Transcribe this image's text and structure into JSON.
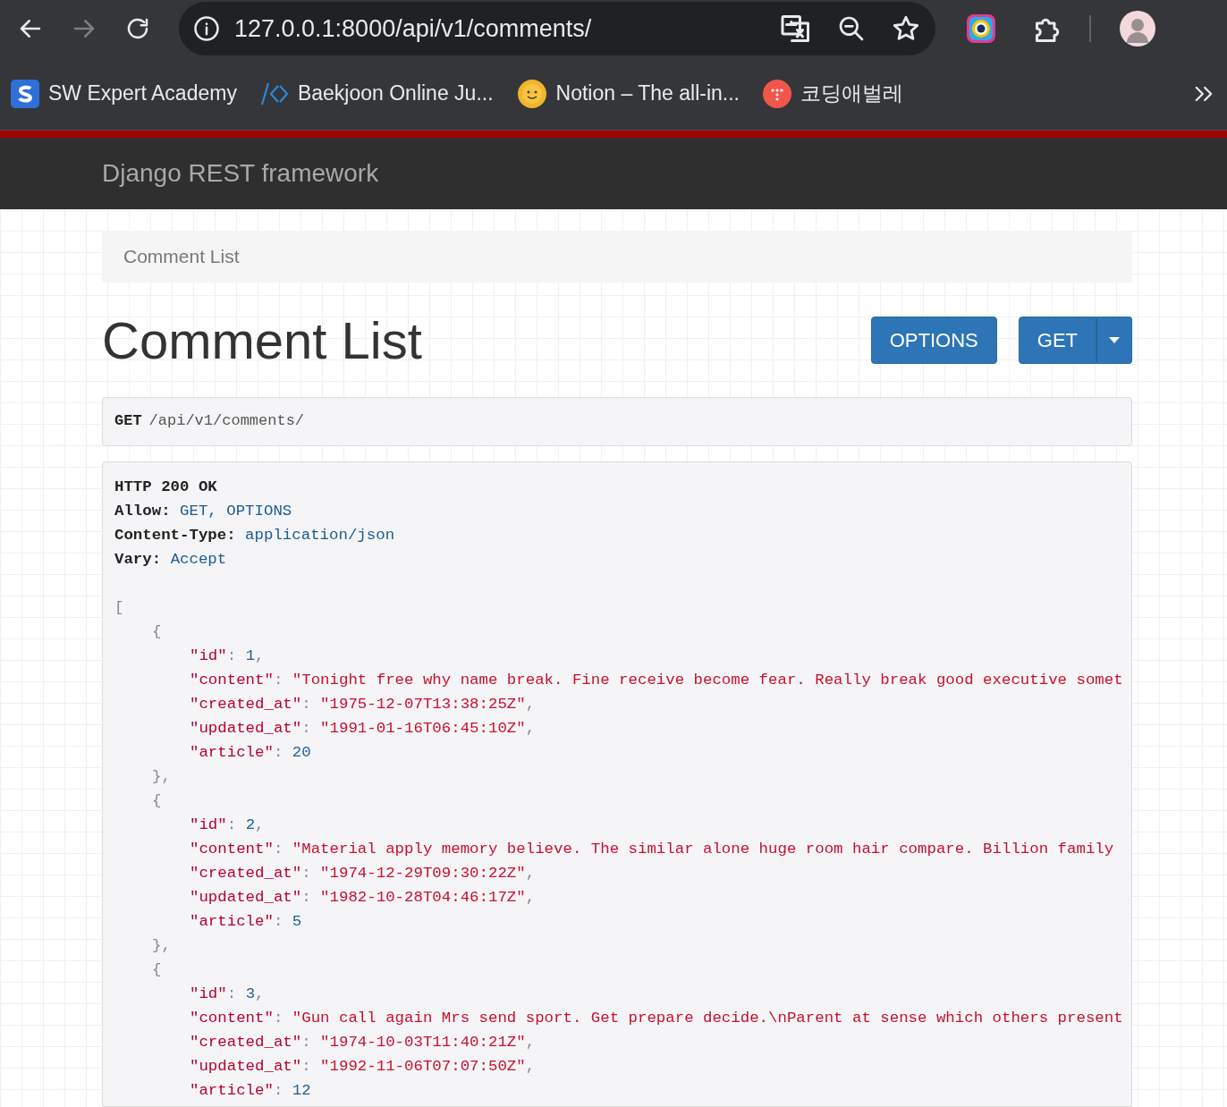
{
  "browser": {
    "nav_buttons": [
      {
        "kind": "back",
        "disabled": false
      },
      {
        "kind": "forward",
        "disabled": true
      },
      {
        "kind": "reload",
        "disabled": false
      }
    ],
    "url": "127.0.0.1:8000/api/v1/comments/",
    "bookmarks": [
      {
        "label": "SW Expert Academy",
        "kind": "s"
      },
      {
        "label": "Baekjoon Online Ju...",
        "kind": "code"
      },
      {
        "label": "Notion – The all-in...",
        "kind": "sun"
      },
      {
        "label": "코딩애벌레",
        "kind": "dots"
      }
    ]
  },
  "navbar": {
    "brand": "Django REST framework"
  },
  "breadcrumb": [
    "Comment List"
  ],
  "page_title": "Comment List",
  "buttons": [
    {
      "label": "OPTIONS",
      "kind": "plain"
    },
    {
      "label": "GET",
      "kind": "split"
    }
  ],
  "request": {
    "method": "GET",
    "path": "/api/v1/comments/"
  },
  "response": {
    "status": "HTTP 200 OK",
    "headers": [
      {
        "name": "Allow:",
        "value": "GET, OPTIONS"
      },
      {
        "name": "Content-Type:",
        "value": "application/json"
      },
      {
        "name": "Vary:",
        "value": "Accept"
      }
    ],
    "open": "[",
    "items": [
      {
        "open": "{",
        "close": "},",
        "fields": [
          {
            "key": "\"id\"",
            "colon": ":",
            "value": "1",
            "kind": "number",
            "comma": ","
          },
          {
            "key": "\"content\"",
            "colon": ":",
            "value": "\"Tonight free why name break. Fine receive become fear. Really break good executive somet",
            "kind": "string"
          },
          {
            "key": "\"created_at\"",
            "colon": ":",
            "value": "\"1975-12-07T13:38:25Z\"",
            "kind": "string",
            "comma": ","
          },
          {
            "key": "\"updated_at\"",
            "colon": ":",
            "value": "\"1991-01-16T06:45:10Z\"",
            "kind": "string",
            "comma": ","
          },
          {
            "key": "\"article\"",
            "colon": ":",
            "value": "20",
            "kind": "number"
          }
        ]
      },
      {
        "open": "{",
        "close": "},",
        "fields": [
          {
            "key": "\"id\"",
            "colon": ":",
            "value": "2",
            "kind": "number",
            "comma": ","
          },
          {
            "key": "\"content\"",
            "colon": ":",
            "value": "\"Material apply memory believe. The similar alone huge room hair compare. Billion family",
            "kind": "string"
          },
          {
            "key": "\"created_at\"",
            "colon": ":",
            "value": "\"1974-12-29T09:30:22Z\"",
            "kind": "string",
            "comma": ","
          },
          {
            "key": "\"updated_at\"",
            "colon": ":",
            "value": "\"1982-10-28T04:46:17Z\"",
            "kind": "string",
            "comma": ","
          },
          {
            "key": "\"article\"",
            "colon": ":",
            "value": "5",
            "kind": "number"
          }
        ]
      },
      {
        "open": "{",
        "fields": [
          {
            "key": "\"id\"",
            "colon": ":",
            "value": "3",
            "kind": "number",
            "comma": ","
          },
          {
            "key": "\"content\"",
            "colon": ":",
            "value": "\"Gun call again Mrs send sport. Get prepare decide.\\nParent at sense which others present",
            "kind": "string"
          },
          {
            "key": "\"created_at\"",
            "colon": ":",
            "value": "\"1974-10-03T11:40:21Z\"",
            "kind": "string",
            "comma": ","
          },
          {
            "key": "\"updated_at\"",
            "colon": ":",
            "value": "\"1992-11-06T07:07:50Z\"",
            "kind": "string",
            "comma": ","
          },
          {
            "key": "\"article\"",
            "colon": ":",
            "value": "12",
            "kind": "number"
          }
        ]
      }
    ]
  }
}
